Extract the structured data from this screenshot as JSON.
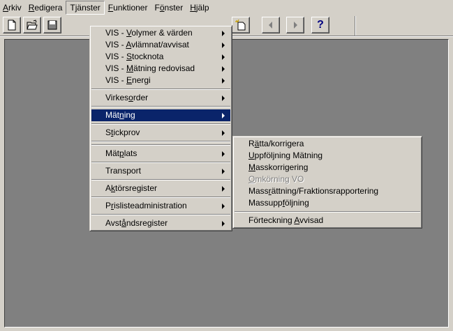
{
  "menubar": {
    "items": [
      {
        "pre": "",
        "u": "A",
        "post": "rkiv"
      },
      {
        "pre": "",
        "u": "R",
        "post": "edigera"
      },
      {
        "pre": "T",
        "u": "j",
        "post": "änster"
      },
      {
        "pre": "",
        "u": "F",
        "post": "unktioner"
      },
      {
        "pre": "F",
        "u": "ö",
        "post": "nster"
      },
      {
        "pre": "",
        "u": "H",
        "post": "jälp"
      }
    ]
  },
  "toolbar": {
    "help_glyph": "?"
  },
  "tjanster_menu": {
    "items": [
      {
        "pre": "VIS - ",
        "u": "V",
        "post": "olymer & värden"
      },
      {
        "pre": "VIS - ",
        "u": "A",
        "post": "vlämnat/avvisat"
      },
      {
        "pre": "VIS - ",
        "u": "S",
        "post": "tocknota"
      },
      {
        "pre": "VIS - ",
        "u": "M",
        "post": "ätning redovisad"
      },
      {
        "pre": "VIS - ",
        "u": "E",
        "post": "nergi"
      },
      {
        "pre": "Virkes",
        "u": "o",
        "post": "rder"
      },
      {
        "pre": "Mät",
        "u": "n",
        "post": "ing"
      },
      {
        "pre": "S",
        "u": "t",
        "post": "ickprov"
      },
      {
        "pre": "Mät",
        "u": "p",
        "post": "lats"
      },
      {
        "pre": "Transport",
        "u": "",
        "post": ""
      },
      {
        "pre": "A",
        "u": "k",
        "post": "törsregister"
      },
      {
        "pre": "P",
        "u": "r",
        "post": "islisteadministration"
      },
      {
        "pre": "Avst",
        "u": "å",
        "post": "ndsregister"
      }
    ]
  },
  "matning_submenu": {
    "items": [
      {
        "pre": "R",
        "u": "ä",
        "post": "tta/korrigera"
      },
      {
        "pre": "",
        "u": "U",
        "post": "ppföljning Mätning"
      },
      {
        "pre": "",
        "u": "M",
        "post": "asskorrigering"
      },
      {
        "pre": "",
        "u": "O",
        "post": "mkörning VO"
      },
      {
        "pre": "Mass",
        "u": "r",
        "post": "ättning/Fraktionsrapportering"
      },
      {
        "pre": "Massupp",
        "u": "f",
        "post": "öljning"
      },
      {
        "pre": "Förteckning ",
        "u": "A",
        "post": "vvisad"
      }
    ]
  }
}
